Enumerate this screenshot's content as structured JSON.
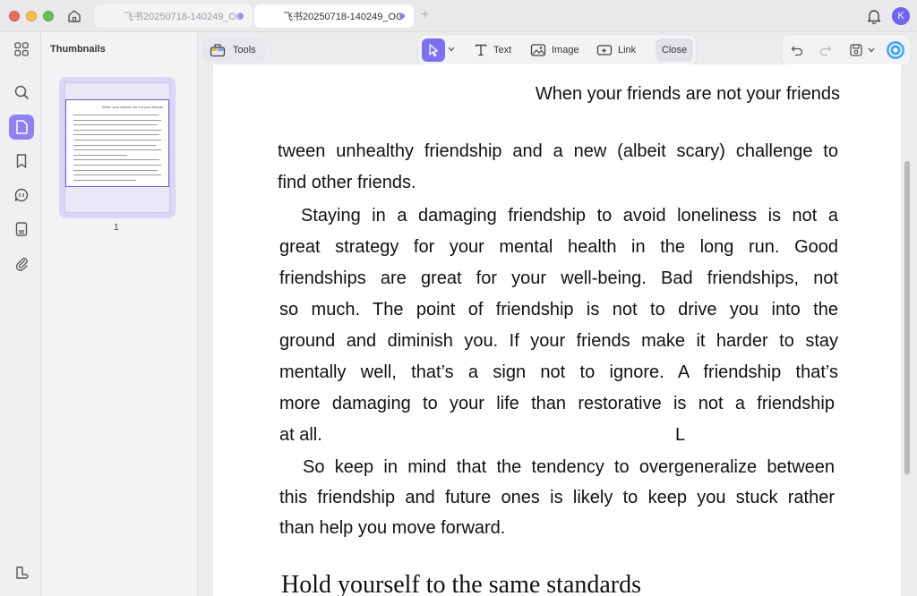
{
  "window": {
    "tabs": [
      {
        "label": "飞书20250718-140249_OC"
      },
      {
        "label": "飞书20250718-140249_OC"
      }
    ],
    "new_tab_symbol": "+",
    "account_initial": "K"
  },
  "sidebar": {
    "rail_icons": [
      "grid-icon",
      "search-icon",
      "document-icon",
      "bookmark-icon",
      "comment-icon",
      "form-icon",
      "paperclip-icon",
      "sidebar-toggle-icon"
    ]
  },
  "thumbnails": {
    "title": "Thumbnails",
    "pages": [
      {
        "number": "1",
        "header_text": "When your friends are not your friends"
      }
    ]
  },
  "toolbar": {
    "tools_label": "Tools",
    "text_label": "Text",
    "image_label": "Image",
    "link_label": "Link",
    "close_label": "Close"
  },
  "document": {
    "header": "When your friends are not your friends",
    "lines": [
      "tween unhealthy friendship and a new (albeit scary) challenge to",
      "find other friends.",
      "Staying in a damaging friendship to avoid loneliness is not a",
      "great strategy for your mental health in the long run. Good",
      "friendships are great for your well-being. Bad friendships, not",
      "so much. The point of friendship is not to drive you into the",
      "ground and diminish you. If your friends make it harder to stay",
      "mentally well, that’s a sign not to ignore. A friendship that’s",
      "more damaging to your life than restorative is not a friendship",
      "at all.",
      "So keep in mind that the tendency to overgeneralize between",
      "this friendship and future ones is likely to keep you stuck rather",
      "than help you move forward."
    ],
    "stray_char": "L",
    "section_heading": "Hold yourself to the same standards"
  },
  "colors": {
    "accent": "#7d70f3",
    "page": "#ffffff",
    "chrome": "#e9e9ec"
  }
}
